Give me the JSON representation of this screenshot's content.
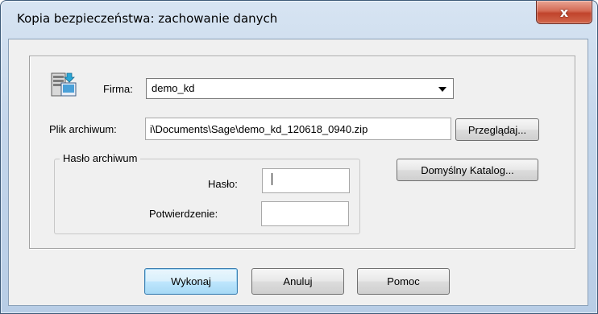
{
  "window": {
    "title": "Kopia bezpieczeństwa: zachowanie danych",
    "close_glyph": "x"
  },
  "firma": {
    "icon": "database-computer-icon",
    "label": "Firma:",
    "selected": "demo_kd"
  },
  "archive": {
    "label": "Plik archiwum:",
    "value": "i\\Documents\\Sage\\demo_kd_120618_0940.zip",
    "browse_label": "Przeglądaj..."
  },
  "default_dir_label": "Domyślny Katalog...",
  "password_group": {
    "legend": "Hasło archiwum",
    "password_label": "Hasło:",
    "password_value": "",
    "confirm_label": "Potwierdzenie:",
    "confirm_value": ""
  },
  "buttons": {
    "execute": "Wykonaj",
    "cancel": "Anuluj",
    "help": "Pomoc"
  },
  "colors": {
    "default_button_border": "#3c7fb1",
    "close_button": "#c0442c"
  }
}
